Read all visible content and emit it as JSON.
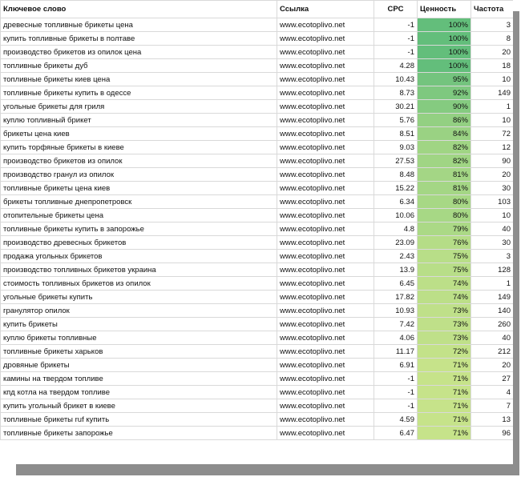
{
  "headers": {
    "keyword": "Ключевое слово",
    "url": "Ссылка",
    "cpc": "CPC",
    "value": "Ценность",
    "freq": "Частота"
  },
  "rows": [
    {
      "keyword": "древесные топливные брикеты цена",
      "url": "www.ecotoplivo.net",
      "cpc": "-1",
      "value": "100%",
      "value_num": 100,
      "freq": "3"
    },
    {
      "keyword": "купить топливные брикеты в полтаве",
      "url": "www.ecotoplivo.net",
      "cpc": "-1",
      "value": "100%",
      "value_num": 100,
      "freq": "8"
    },
    {
      "keyword": "производство брикетов из опилок цена",
      "url": "www.ecotoplivo.net",
      "cpc": "-1",
      "value": "100%",
      "value_num": 100,
      "freq": "20"
    },
    {
      "keyword": "топливные брикеты дуб",
      "url": "www.ecotoplivo.net",
      "cpc": "4.28",
      "value": "100%",
      "value_num": 100,
      "freq": "18"
    },
    {
      "keyword": "топливные брикеты киев цена",
      "url": "www.ecotoplivo.net",
      "cpc": "10.43",
      "value": "95%",
      "value_num": 95,
      "freq": "10"
    },
    {
      "keyword": "топливные брикеты купить в одессе",
      "url": "www.ecotoplivo.net",
      "cpc": "8.73",
      "value": "92%",
      "value_num": 92,
      "freq": "149"
    },
    {
      "keyword": "угольные брикеты для гриля",
      "url": "www.ecotoplivo.net",
      "cpc": "30.21",
      "value": "90%",
      "value_num": 90,
      "freq": "1"
    },
    {
      "keyword": "куплю топливный брикет",
      "url": "www.ecotoplivo.net",
      "cpc": "5.76",
      "value": "86%",
      "value_num": 86,
      "freq": "10"
    },
    {
      "keyword": "брикеты цена киев",
      "url": "www.ecotoplivo.net",
      "cpc": "8.51",
      "value": "84%",
      "value_num": 84,
      "freq": "72"
    },
    {
      "keyword": "купить торфяные брикеты в киеве",
      "url": "www.ecotoplivo.net",
      "cpc": "9.03",
      "value": "82%",
      "value_num": 82,
      "freq": "12"
    },
    {
      "keyword": "производство брикетов из опилок",
      "url": "www.ecotoplivo.net",
      "cpc": "27.53",
      "value": "82%",
      "value_num": 82,
      "freq": "90"
    },
    {
      "keyword": "производство гранул из опилок",
      "url": "www.ecotoplivo.net",
      "cpc": "8.48",
      "value": "81%",
      "value_num": 81,
      "freq": "20"
    },
    {
      "keyword": "топливные брикеты цена киев",
      "url": "www.ecotoplivo.net",
      "cpc": "15.22",
      "value": "81%",
      "value_num": 81,
      "freq": "30"
    },
    {
      "keyword": "брикеты топливные днепропетровск",
      "url": "www.ecotoplivo.net",
      "cpc": "6.34",
      "value": "80%",
      "value_num": 80,
      "freq": "103"
    },
    {
      "keyword": "отопительные брикеты цена",
      "url": "www.ecotoplivo.net",
      "cpc": "10.06",
      "value": "80%",
      "value_num": 80,
      "freq": "10"
    },
    {
      "keyword": "топливные брикеты купить в запорожье",
      "url": "www.ecotoplivo.net",
      "cpc": "4.8",
      "value": "79%",
      "value_num": 79,
      "freq": "40"
    },
    {
      "keyword": "производство древесных брикетов",
      "url": "www.ecotoplivo.net",
      "cpc": "23.09",
      "value": "76%",
      "value_num": 76,
      "freq": "30"
    },
    {
      "keyword": "продажа угольных брикетов",
      "url": "www.ecotoplivo.net",
      "cpc": "2.43",
      "value": "75%",
      "value_num": 75,
      "freq": "3"
    },
    {
      "keyword": "производство топливных брикетов украина",
      "url": "www.ecotoplivo.net",
      "cpc": "13.9",
      "value": "75%",
      "value_num": 75,
      "freq": "128"
    },
    {
      "keyword": "стоимость топливных брикетов из опилок",
      "url": "www.ecotoplivo.net",
      "cpc": "6.45",
      "value": "74%",
      "value_num": 74,
      "freq": "1"
    },
    {
      "keyword": "угольные брикеты купить",
      "url": "www.ecotoplivo.net",
      "cpc": "17.82",
      "value": "74%",
      "value_num": 74,
      "freq": "149"
    },
    {
      "keyword": "гранулятор опилок",
      "url": "www.ecotoplivo.net",
      "cpc": "10.93",
      "value": "73%",
      "value_num": 73,
      "freq": "140"
    },
    {
      "keyword": "купить брикеты",
      "url": "www.ecotoplivo.net",
      "cpc": "7.42",
      "value": "73%",
      "value_num": 73,
      "freq": "260"
    },
    {
      "keyword": "куплю брикеты топливные",
      "url": "www.ecotoplivo.net",
      "cpc": "4.06",
      "value": "73%",
      "value_num": 73,
      "freq": "40"
    },
    {
      "keyword": "топливные брикеты харьков",
      "url": "www.ecotoplivo.net",
      "cpc": "11.17",
      "value": "72%",
      "value_num": 72,
      "freq": "212"
    },
    {
      "keyword": "дровяные брикеты",
      "url": "www.ecotoplivo.net",
      "cpc": "6.91",
      "value": "71%",
      "value_num": 71,
      "freq": "20"
    },
    {
      "keyword": "камины на твердом топливе",
      "url": "www.ecotoplivo.net",
      "cpc": "-1",
      "value": "71%",
      "value_num": 71,
      "freq": "27"
    },
    {
      "keyword": "кпд котла на твердом топливе",
      "url": "www.ecotoplivo.net",
      "cpc": "-1",
      "value": "71%",
      "value_num": 71,
      "freq": "4"
    },
    {
      "keyword": "купить угольный брикет в киеве",
      "url": "www.ecotoplivo.net",
      "cpc": "-1",
      "value": "71%",
      "value_num": 71,
      "freq": "7"
    },
    {
      "keyword": "топливные брикеты ruf купить",
      "url": "www.ecotoplivo.net",
      "cpc": "4.59",
      "value": "71%",
      "value_num": 71,
      "freq": "13"
    },
    {
      "keyword": "топливные брикеты запорожье",
      "url": "www.ecotoplivo.net",
      "cpc": "6.47",
      "value": "71%",
      "value_num": 71,
      "freq": "96"
    }
  ],
  "colors": {
    "value_high": "#63be7b",
    "value_low": "#c6e38a",
    "grid": "#d9d9d9",
    "shadow": "#8d8d8d"
  }
}
